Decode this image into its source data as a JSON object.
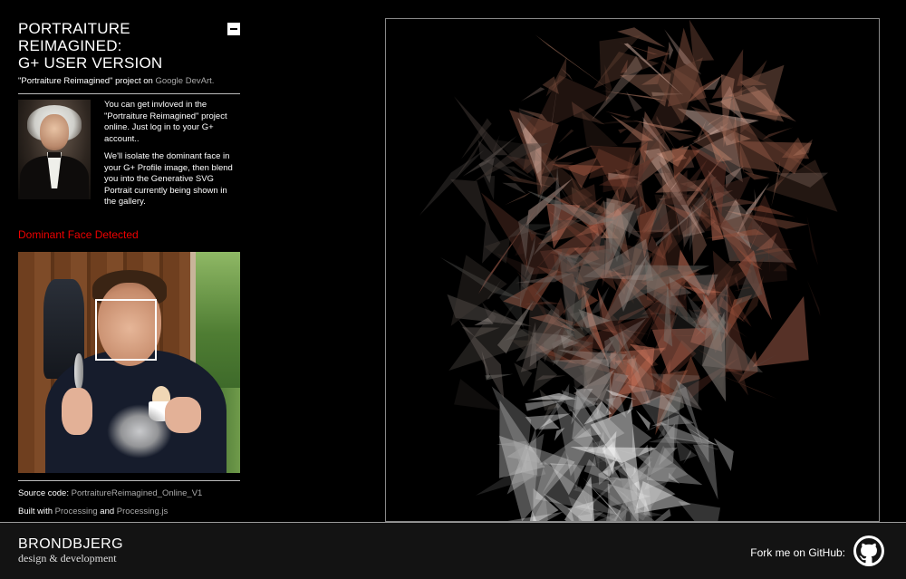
{
  "sidebar": {
    "title_line1": "PORTRAITURE REIMAGINED:",
    "title_line2": "G+ USER VERSION",
    "project_prefix": "\"Portraiture Reimagined\" project on ",
    "project_link": "Google DevArt.",
    "intro_p1": "You can get invloved in the \"Portraiture Reimagined\" project online. Just log in to your G+ account..",
    "intro_p2": "We'll isolate the dominant face in your G+ Profile image, then blend you into the Generative SVG Portrait currently being shown in the gallery.",
    "detected_label": "Dominant Face Detected",
    "source_label": "Source code: ",
    "source_link": "PortraitureReimagined_Online_V1",
    "built_prefix": "Built with ",
    "built_link1": "Processing",
    "built_and": " and ",
    "built_link2": "Processing.js"
  },
  "footer": {
    "brand_name": "BRONDBJERG",
    "brand_sub": "design & development",
    "fork_label": "Fork me on GitHub:"
  },
  "icons": {
    "collapse": "minus-square-icon",
    "github": "github-icon"
  },
  "colors": {
    "background": "#000000",
    "accent_red": "#ee0000",
    "link_grey": "#aaaaaa",
    "footer_bg": "#131313"
  }
}
